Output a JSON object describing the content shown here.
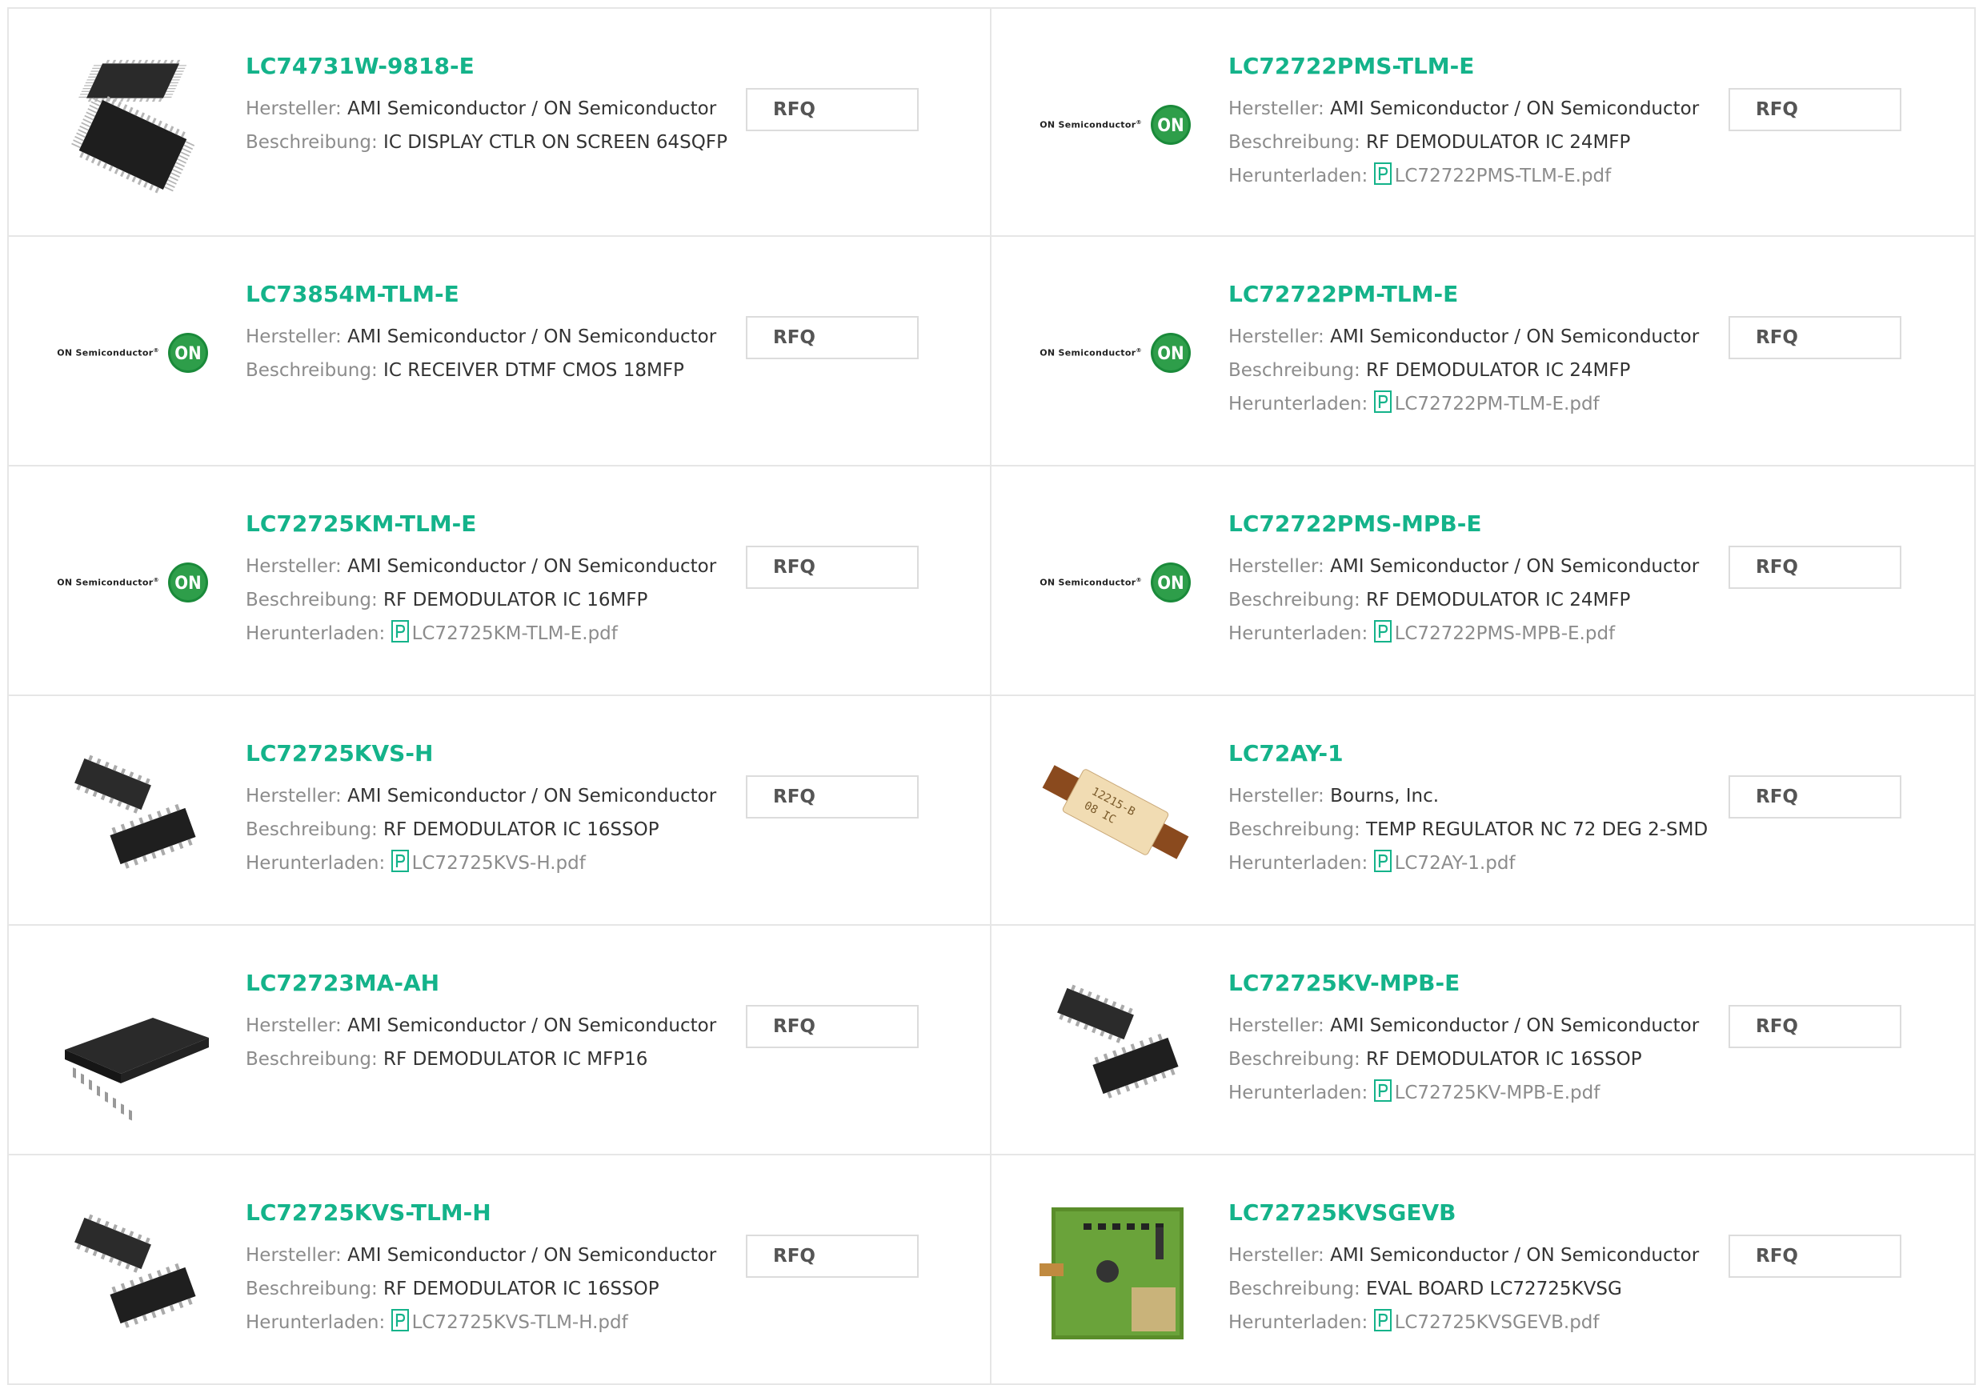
{
  "labels": {
    "manufacturer": "Hersteller:",
    "description": "Beschreibung:",
    "download": "Herunterladen:",
    "rfq": "RFQ"
  },
  "logo_text": "ON Semiconductor",
  "logo_mark": "ON",
  "colors": {
    "accent": "#14b38a",
    "label": "#8c8c8c",
    "border": "#e6e6e6",
    "on_logo": "#1a8a3a"
  },
  "products": [
    {
      "part": "LC74731W-9818-E",
      "manufacturer": "AMI Semiconductor / ON Semiconductor",
      "description": "IC DISPLAY CTLR ON SCREEN 64SQFP",
      "image": "qfp-chip-icon"
    },
    {
      "part": "LC72722PMS-TLM-E",
      "manufacturer": "AMI Semiconductor / ON Semiconductor",
      "description": "RF DEMODULATOR IC 24MFP",
      "download": "LC72722PMS-TLM-E.pdf",
      "image": "on-semiconductor-logo"
    },
    {
      "part": "LC73854M-TLM-E",
      "manufacturer": "AMI Semiconductor / ON Semiconductor",
      "description": "IC RECEIVER DTMF CMOS 18MFP",
      "image": "on-semiconductor-logo"
    },
    {
      "part": "LC72722PM-TLM-E",
      "manufacturer": "AMI Semiconductor / ON Semiconductor",
      "description": "RF DEMODULATOR IC 24MFP",
      "download": "LC72722PM-TLM-E.pdf",
      "image": "on-semiconductor-logo"
    },
    {
      "part": "LC72725KM-TLM-E",
      "manufacturer": "AMI Semiconductor / ON Semiconductor",
      "description": "RF DEMODULATOR IC 16MFP",
      "download": "LC72725KM-TLM-E.pdf",
      "image": "on-semiconductor-logo"
    },
    {
      "part": "LC72722PMS-MPB-E",
      "manufacturer": "AMI Semiconductor / ON Semiconductor",
      "description": "RF DEMODULATOR IC 24MFP",
      "download": "LC72722PMS-MPB-E.pdf",
      "image": "on-semiconductor-logo"
    },
    {
      "part": "LC72725KVS-H",
      "manufacturer": "AMI Semiconductor / ON Semiconductor",
      "description": "RF DEMODULATOR IC 16SSOP",
      "download": "LC72725KVS-H.pdf",
      "image": "ssop-chip-icon"
    },
    {
      "part": "LC72AY-1",
      "manufacturer": "Bourns, Inc.",
      "description": "TEMP REGULATOR NC 72 DEG 2-SMD",
      "download": "LC72AY-1.pdf",
      "image": "thermal-cutoff-icon"
    },
    {
      "part": "LC72723MA-AH",
      "manufacturer": "AMI Semiconductor / ON Semiconductor",
      "description": "RF DEMODULATOR IC MFP16",
      "image": "soic-chip-icon"
    },
    {
      "part": "LC72725KV-MPB-E",
      "manufacturer": "AMI Semiconductor / ON Semiconductor",
      "description": "RF DEMODULATOR IC 16SSOP",
      "download": "LC72725KV-MPB-E.pdf",
      "image": "ssop-chip-icon"
    },
    {
      "part": "LC72725KVS-TLM-H",
      "manufacturer": "AMI Semiconductor / ON Semiconductor",
      "description": "RF DEMODULATOR IC 16SSOP",
      "download": "LC72725KVS-TLM-H.pdf",
      "image": "ssop-chip-icon"
    },
    {
      "part": "LC72725KVSGEVB",
      "manufacturer": "AMI Semiconductor / ON Semiconductor",
      "description": "EVAL BOARD LC72725KVSG",
      "download": "LC72725KVSGEVB.pdf",
      "image": "eval-board-icon"
    }
  ]
}
